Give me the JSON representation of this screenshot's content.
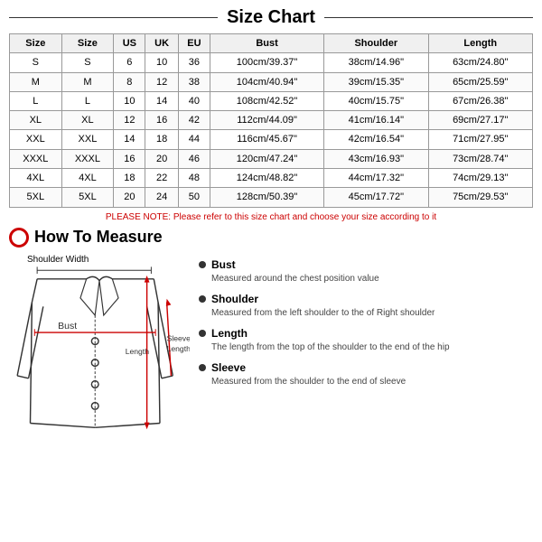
{
  "title": "Size Chart",
  "table": {
    "headers": [
      "Size",
      "Size",
      "US",
      "UK",
      "EU",
      "Bust",
      "Shoulder",
      "Length"
    ],
    "rows": [
      [
        "S",
        "S",
        "6",
        "10",
        "36",
        "100cm/39.37\"",
        "38cm/14.96\"",
        "63cm/24.80\""
      ],
      [
        "M",
        "M",
        "8",
        "12",
        "38",
        "104cm/40.94\"",
        "39cm/15.35\"",
        "65cm/25.59\""
      ],
      [
        "L",
        "L",
        "10",
        "14",
        "40",
        "108cm/42.52\"",
        "40cm/15.75\"",
        "67cm/26.38\""
      ],
      [
        "XL",
        "XL",
        "12",
        "16",
        "42",
        "112cm/44.09\"",
        "41cm/16.14\"",
        "69cm/27.17\""
      ],
      [
        "XXL",
        "XXL",
        "14",
        "18",
        "44",
        "116cm/45.67\"",
        "42cm/16.54\"",
        "71cm/27.95\""
      ],
      [
        "XXXL",
        "XXXL",
        "16",
        "20",
        "46",
        "120cm/47.24\"",
        "43cm/16.93\"",
        "73cm/28.74\""
      ],
      [
        "4XL",
        "4XL",
        "18",
        "22",
        "48",
        "124cm/48.82\"",
        "44cm/17.32\"",
        "74cm/29.13\""
      ],
      [
        "5XL",
        "5XL",
        "20",
        "24",
        "50",
        "128cm/50.39\"",
        "45cm/17.72\"",
        "75cm/29.53\""
      ]
    ]
  },
  "note": "PLEASE NOTE: Please refer to this size chart and choose your size according to it",
  "how_to_measure_title": "How To Measure",
  "diagram": {
    "shoulder_width_label": "Shoulder Width",
    "bust_label": "Bust",
    "sleeve_length_label": "Sleeve\nLength",
    "length_label": "Length"
  },
  "measurements": [
    {
      "title": "Bust",
      "desc": "Measured around the chest position value"
    },
    {
      "title": "Shoulder",
      "desc": "Measured from the left shoulder to the of Right shoulder"
    },
    {
      "title": "Length",
      "desc": "The length from the top of the shoulder to the end of the hip"
    },
    {
      "title": "Sleeve",
      "desc": "Measured from the shoulder to the end of sleeve"
    }
  ]
}
